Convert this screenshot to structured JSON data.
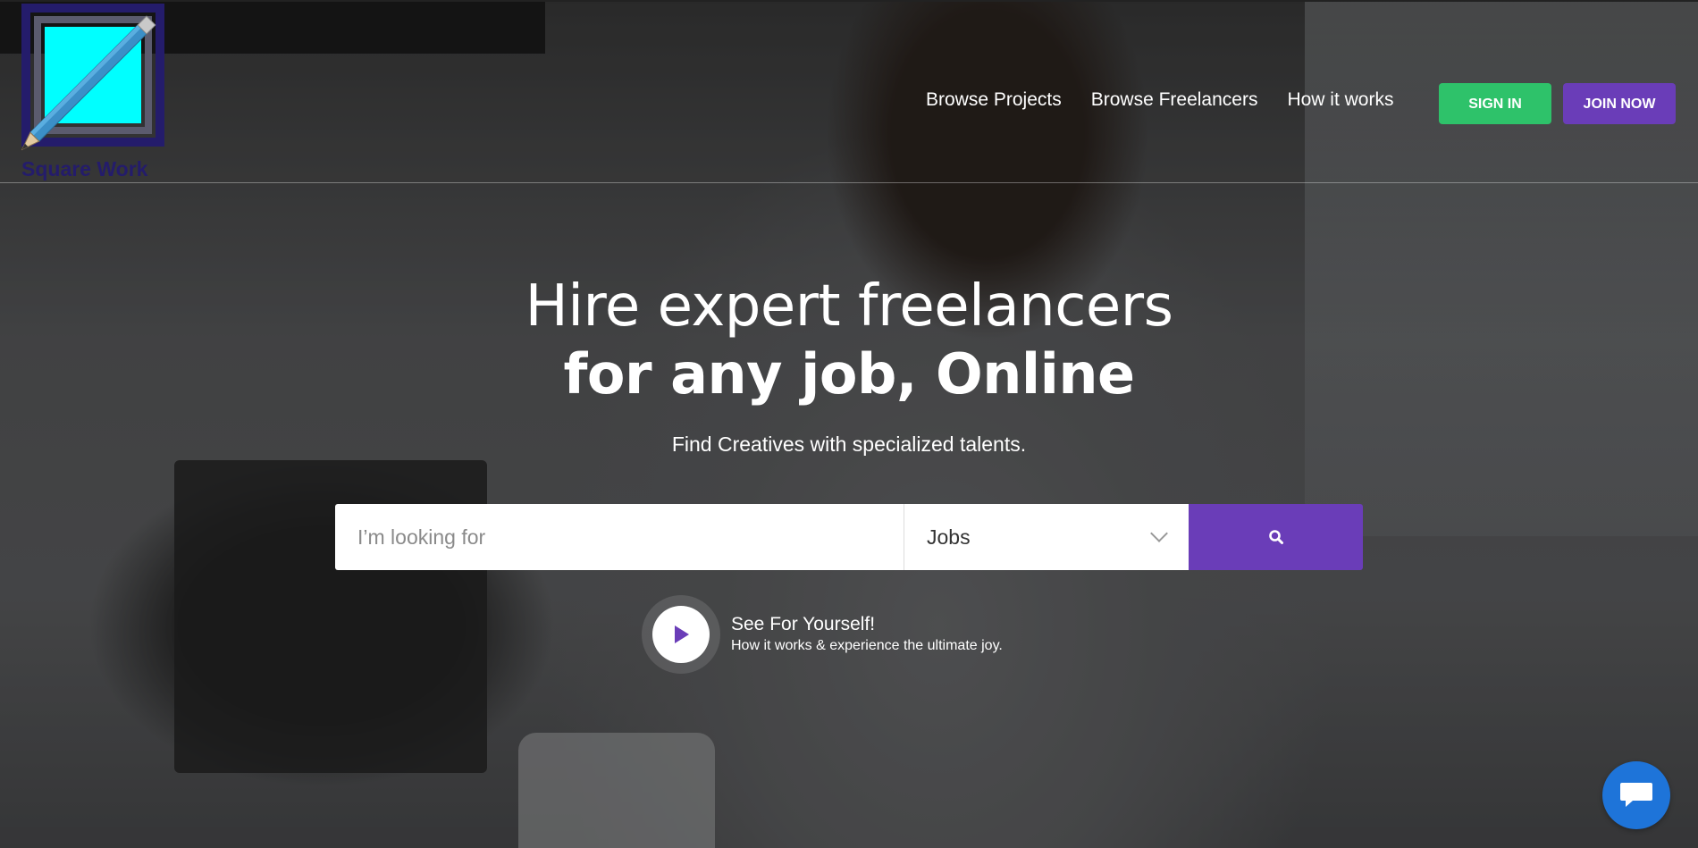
{
  "brand": {
    "name": "Square Work",
    "colors": {
      "logo_navy": "#241c6b",
      "logo_cyan": "#00ffff",
      "signin_green": "#2ec26a",
      "join_purple": "#6a3db8",
      "chat_blue": "#1e74d9"
    }
  },
  "nav": {
    "links": [
      "Browse Projects",
      "Browse Freelancers",
      "How it works"
    ],
    "signin_label": "SIGN IN",
    "join_label": "JOIN NOW"
  },
  "hero": {
    "headline_line1": "Hire expert freelancers",
    "headline_line2": "for any job, Online",
    "subtitle": "Find Creatives with specialized talents."
  },
  "search": {
    "placeholder": "I’m looking for",
    "category_selected": "Jobs",
    "button_icon": "search-icon"
  },
  "video_cta": {
    "title": "See For Yourself!",
    "subtitle": "How it works & experience the ultimate joy.",
    "icon": "play-icon"
  },
  "chat": {
    "icon": "chat-icon"
  }
}
